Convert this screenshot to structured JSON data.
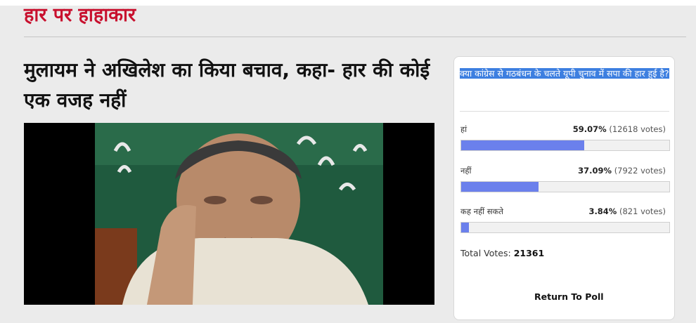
{
  "section": {
    "title": "हार पर हाहाकार"
  },
  "article": {
    "headline": "मुलायम ने अखिलेश का किया बचाव, कहा- हार की कोई एक वजह नहीं"
  },
  "poll": {
    "question": "क्या कांग्रेस से गठबंधन के चलते यूपी चुनाव में सपा की हार हुई है?",
    "answers": [
      {
        "label": "हां",
        "percent": "59.07%",
        "votes": "(12618 votes)",
        "fraction": 0.5907
      },
      {
        "label": "नहीं",
        "percent": "37.09%",
        "votes": "(7922 votes)",
        "fraction": 0.3709
      },
      {
        "label": "कह नहीं सकते",
        "percent": "3.84%",
        "votes": "(821 votes)",
        "fraction": 0.0384
      }
    ],
    "total_label": "Total Votes:",
    "total_value": "21361",
    "return_label": "Return To Poll"
  },
  "colors": {
    "section_title": "#c8102e",
    "bar_fill": "#6b80ec",
    "selection_highlight": "#3d7fe0"
  }
}
